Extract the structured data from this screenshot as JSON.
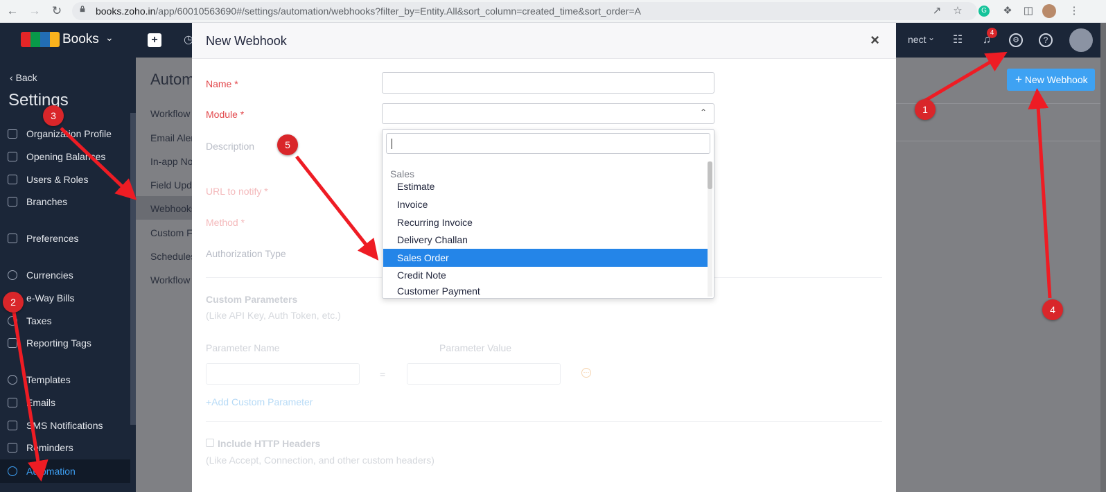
{
  "browser": {
    "url_host": "books.zoho.in",
    "url_path": "/app/60010563690#/settings/automation/webhooks?filter_by=Entity.All&sort_column=created_time&sort_order=A"
  },
  "app": {
    "brand": "Books",
    "connect_partial": "nect",
    "notification_count": "4",
    "new_webhook_button": "New Webhook"
  },
  "sidebar": {
    "back": "Back",
    "title": "Settings",
    "items": [
      {
        "label": "Organization Profile"
      },
      {
        "label": "Opening Balances"
      },
      {
        "label": "Users & Roles"
      },
      {
        "label": "Branches"
      },
      {
        "label": "Preferences"
      },
      {
        "label": "Currencies"
      },
      {
        "label": "e-Way Bills"
      },
      {
        "label": "Taxes"
      },
      {
        "label": "Reporting Tags"
      },
      {
        "label": "Templates"
      },
      {
        "label": "Emails"
      },
      {
        "label": "SMS Notifications"
      },
      {
        "label": "Reminders"
      },
      {
        "label": "Automation"
      }
    ]
  },
  "submenu": {
    "title_partial": "Autom",
    "items": [
      "Workflow",
      "Email Aler",
      "In-app No",
      "Field Upda",
      "Webhooks",
      "Custom Fu",
      "Schedules",
      "Workflow"
    ]
  },
  "modal": {
    "title": "New Webhook",
    "close": "×",
    "name_label": "Name *",
    "module_label": "Module *",
    "description_label": "Description",
    "url_label": "URL to notify *",
    "method_label": "Method *",
    "auth_label": "Authorization Type",
    "custom_params_title": "Custom Parameters",
    "custom_params_hint": "(Like API Key, Auth Token, etc.)",
    "param_name": "Parameter Name",
    "param_value": "Parameter Value",
    "equals": "=",
    "add_param": "+Add Custom Parameter",
    "http_headers": "Include HTTP Headers",
    "http_headers_hint": "(Like Accept, Connection, and other custom headers)"
  },
  "dropdown": {
    "search_value": "",
    "group": "Sales",
    "items": [
      "Estimate",
      "Invoice",
      "Recurring Invoice",
      "Delivery Challan",
      "Sales Order",
      "Credit Note",
      "Customer Payment"
    ],
    "selected": "Sales Order"
  },
  "markers": [
    "1",
    "2",
    "3",
    "4",
    "5"
  ],
  "colors": {
    "sidebar": "#1b2638",
    "accent": "#2485e8",
    "marker": "#d9262a",
    "required": "#e2474b"
  }
}
